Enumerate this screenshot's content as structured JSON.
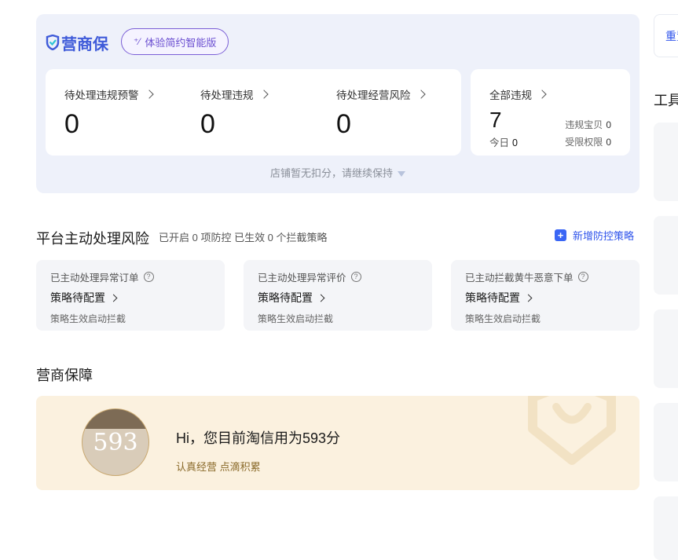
{
  "brand": {
    "name": "营商保",
    "accent": "#3f5bd9"
  },
  "trial_button": {
    "label": "体验简约智能版"
  },
  "stats": [
    {
      "label": "待处理违规预警",
      "value": "0"
    },
    {
      "label": "待处理违规",
      "value": "0"
    },
    {
      "label": "待处理经营风险",
      "value": "0"
    }
  ],
  "all_violations": {
    "label": "全部违规",
    "value": "7",
    "today_label": "今日",
    "today_value": "0",
    "items": [
      {
        "label": "违规宝贝",
        "value": "0"
      },
      {
        "label": "受限权限",
        "value": "0"
      }
    ]
  },
  "notice": "店铺暂无扣分，请继续保持",
  "platform": {
    "title": "平台主动处理风险",
    "subtitle": "已开启 0 项防控 已生效 0 个拦截策略",
    "add_button": "新增防控策略",
    "cards": [
      {
        "label": "已主动处理异常订单",
        "value": "策略待配置",
        "sub": "策略生效启动拦截"
      },
      {
        "label": "已主动处理异常评价",
        "value": "策略待配置",
        "sub": "策略生效启动拦截"
      },
      {
        "label": "已主动拦截黄牛恶意下单",
        "value": "策略待配置",
        "sub": "策略生效启动拦截"
      }
    ]
  },
  "guarantee": {
    "title": "营商保障",
    "score": "593",
    "headline": "Hi，您目前淘信用为593分",
    "sub": "认真经营 点滴积累"
  },
  "right": {
    "reset_label": "重置",
    "tools_title": "工具"
  },
  "icons": {
    "brand": "shield-check-icon",
    "trial": "sparkle-wand-icon",
    "add": "plus-square-icon",
    "help": "question-circle-icon",
    "notice": "caret-down-icon"
  }
}
